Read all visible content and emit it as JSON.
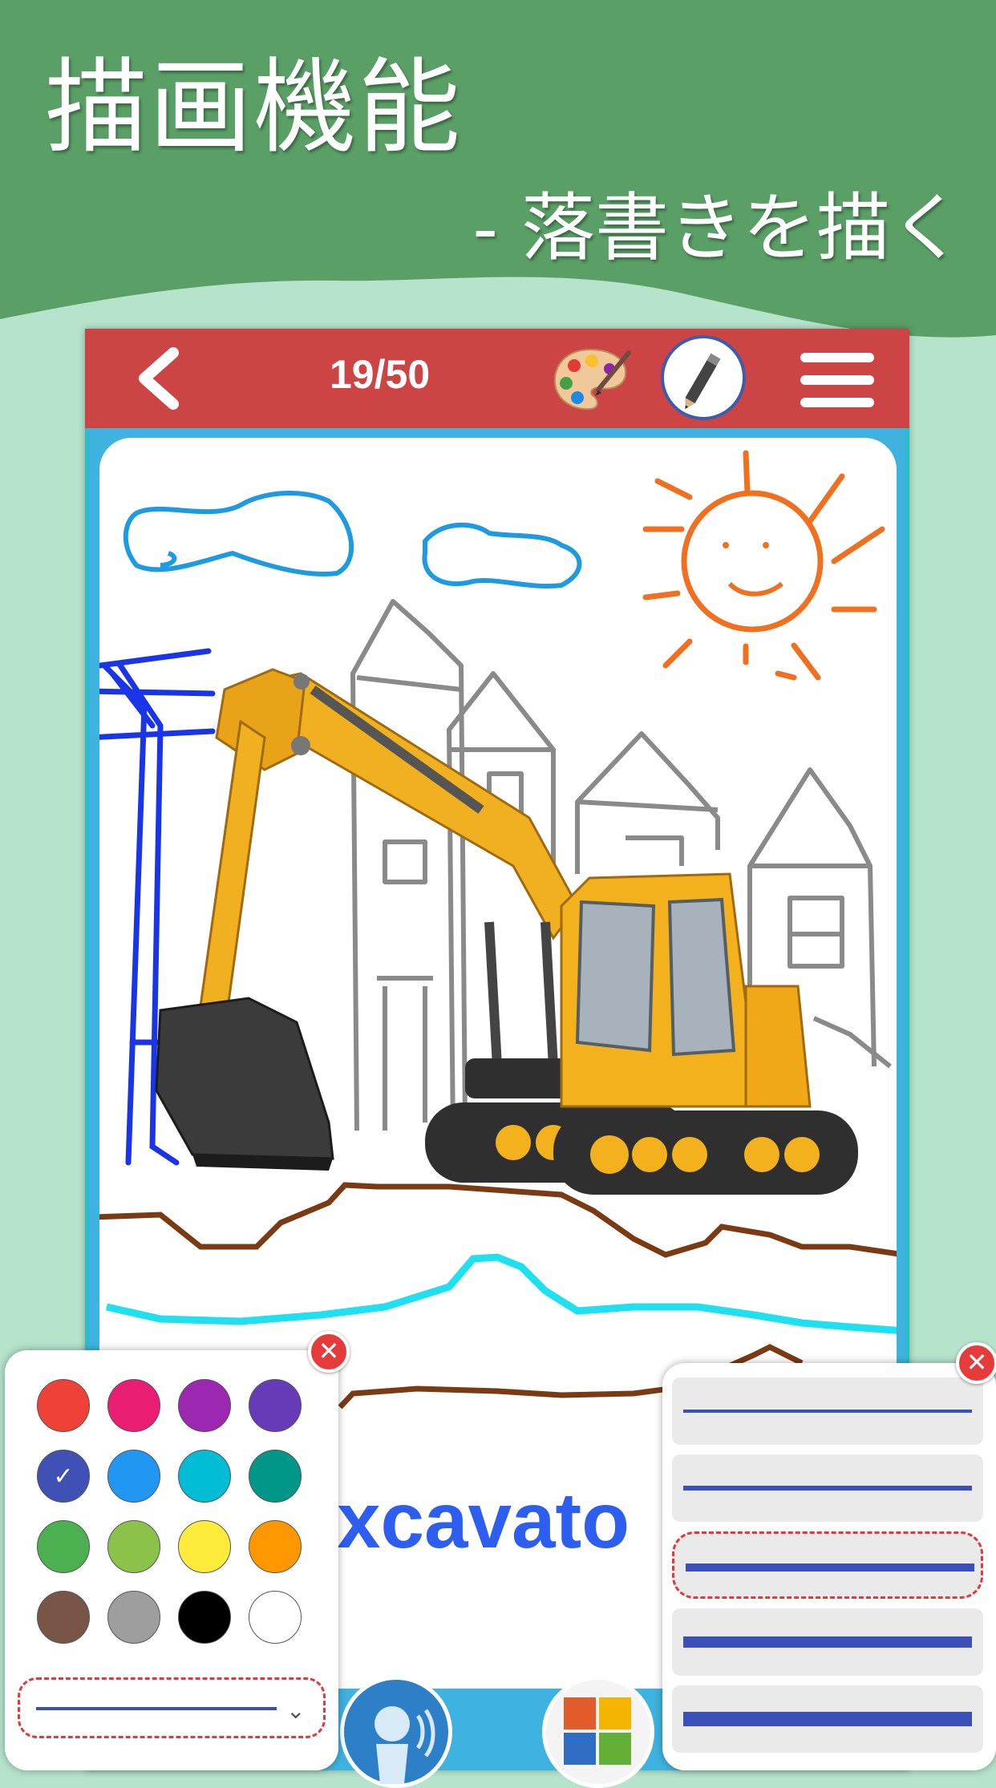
{
  "banner": {
    "title": "描画機能",
    "subtitle": "- 落書きを描く",
    "color": "#5a9f66"
  },
  "toolbar": {
    "back_icon": "chevron-left-icon",
    "page_indicator": "19/50",
    "palette_icon": "palette-icon",
    "pen_icon": "pencil-icon",
    "menu_icon": "hamburger-menu-icon",
    "bar_color": "#cc4444"
  },
  "card": {
    "word": "xcavato"
  },
  "color_picker": {
    "colors": [
      "#ef4136",
      "#e91e73",
      "#9c27b0",
      "#673ab7",
      "#3f51b5",
      "#2196f3",
      "#00bcd4",
      "#009688",
      "#4caf50",
      "#8bc34a",
      "#ffeb3b",
      "#ff9800",
      "#795548",
      "#9e9e9e",
      "#000000",
      "#ffffff"
    ],
    "selected_index": 4,
    "selected_mark": "✓",
    "close_label": "✕"
  },
  "stroke_picker": {
    "widths": [
      2,
      3,
      5,
      7,
      9
    ],
    "selected_index": 2,
    "close_label": "✕"
  },
  "bottom_buttons": [
    "speaker-icon",
    "puzzle-icon"
  ]
}
